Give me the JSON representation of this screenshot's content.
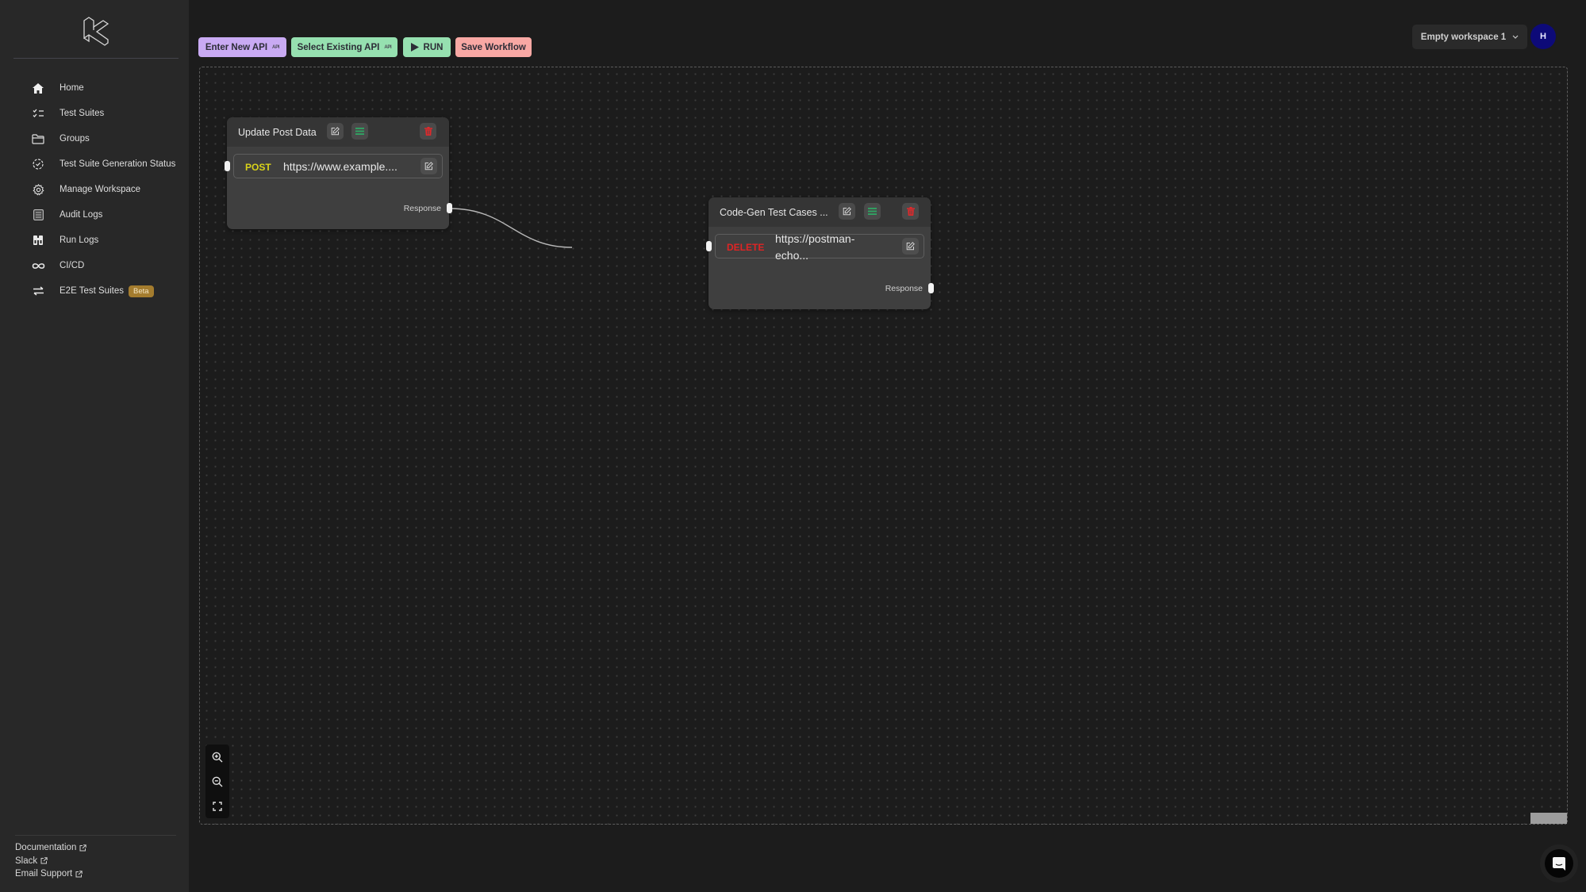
{
  "sidebar": {
    "items": [
      {
        "label": "Home",
        "icon": "home-icon"
      },
      {
        "label": "Test Suites",
        "icon": "checklist-icon"
      },
      {
        "label": "Groups",
        "icon": "folder-icon"
      },
      {
        "label": "Test Suite Generation Status",
        "icon": "status-cycle-icon"
      },
      {
        "label": "Manage Workspace",
        "icon": "gear-icon"
      },
      {
        "label": "Audit Logs",
        "icon": "list-icon"
      },
      {
        "label": "Run Logs",
        "icon": "binoculars-icon"
      },
      {
        "label": "CI/CD",
        "icon": "infinity-icon"
      },
      {
        "label": "E2E Test Suites",
        "icon": "swap-arrows-icon",
        "badge": "Beta"
      }
    ],
    "footer": [
      {
        "label": "Documentation"
      },
      {
        "label": "Slack"
      },
      {
        "label": "Email Support"
      }
    ]
  },
  "toolbar": {
    "enter_new_api": "Enter New API",
    "select_existing_api": "Select Existing API",
    "api_badge": "API",
    "run": "RUN",
    "save_workflow": "Save Workflow"
  },
  "workspace": {
    "selected": "Empty workspace 1",
    "avatar_initial": "H"
  },
  "nodes": [
    {
      "title": "Update Post Data",
      "method": "POST",
      "method_color": "#d8d21a",
      "url": "https://www.example....",
      "output_label": "Response"
    },
    {
      "title": "Code-Gen Test Cases ...",
      "method": "DELETE",
      "method_color": "#e02424",
      "url_line1": "https://postman-",
      "url_line2": "echo...",
      "output_label": "Response"
    }
  ],
  "colors": {
    "enter_new_api": "#c9aaf3",
    "select_existing_api": "#96e0b0",
    "run": "#96e0b0",
    "save_workflow": "#f8a8a4",
    "beta_badge": "#a47c2e",
    "avatar": "#0d0a78",
    "delete_icon": "#e0292b",
    "menu_icon": "#2fa763"
  }
}
